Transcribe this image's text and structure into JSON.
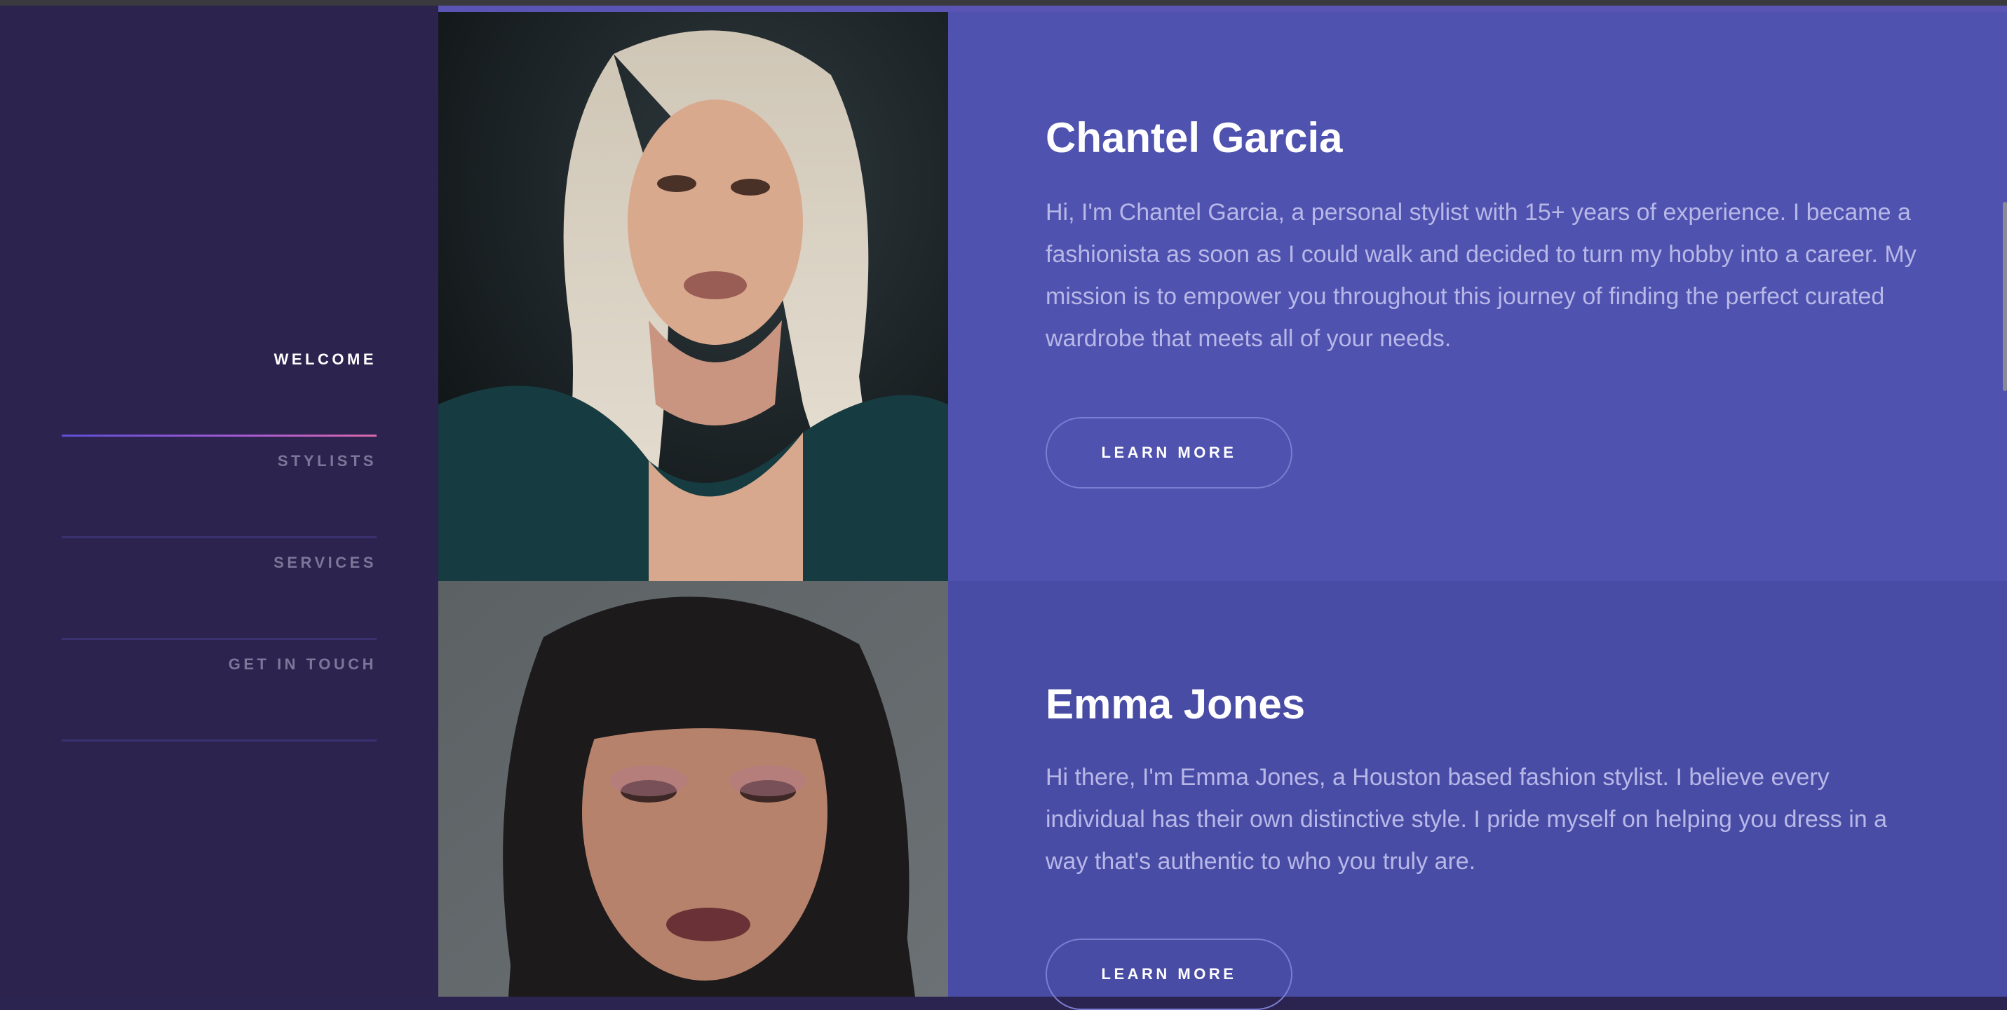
{
  "nav": {
    "items": [
      {
        "label": "WELCOME",
        "active": true
      },
      {
        "label": "STYLISTS",
        "active": false
      },
      {
        "label": "SERVICES",
        "active": false
      },
      {
        "label": "GET IN TOUCH",
        "active": false
      }
    ]
  },
  "stylists": [
    {
      "name": "Chantel Garcia",
      "bio": "Hi, I'm Chantel Garcia, a personal stylist with 15+ years of experience. I became a fashionista as soon as I could walk and decided to turn my hobby into a career. My mission is to empower you throughout this journey of finding the perfect curated wardrobe that meets all of your needs.",
      "button": "LEARN MORE"
    },
    {
      "name": "Emma Jones",
      "bio": "Hi there, I'm Emma Jones, a Houston based fashion stylist. I believe every individual has their own distinctive style. I pride myself on helping you dress in a way that's authentic to who you truly are.",
      "button": "LEARN MORE"
    }
  ],
  "colors": {
    "sidebar": "#2c234f",
    "card_primary": "#4f52ae",
    "card_secondary": "#494ca5",
    "accent_gradient_start": "#5b4fd6",
    "accent_gradient_end": "#d66aa9"
  }
}
